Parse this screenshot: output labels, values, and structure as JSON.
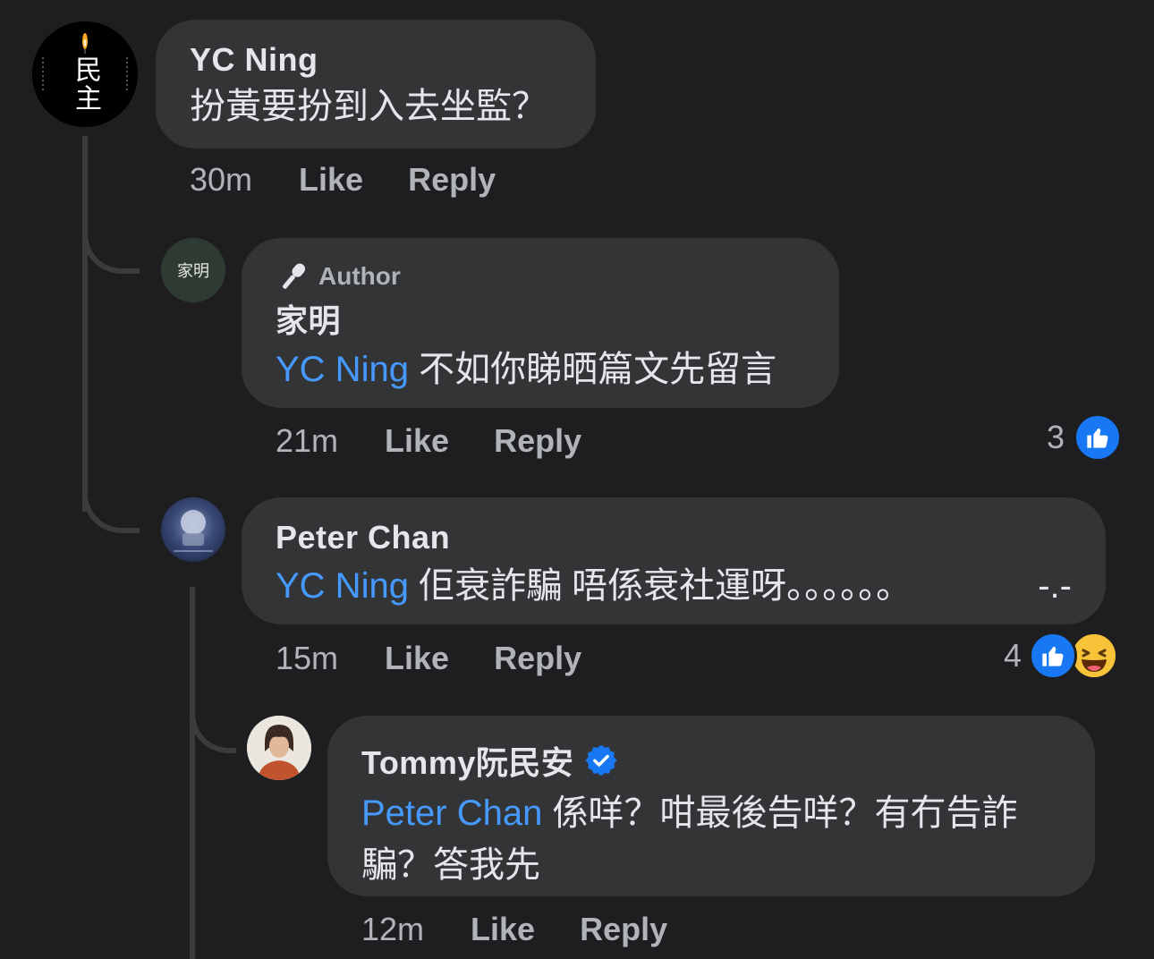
{
  "comments": [
    {
      "author": "YC Ning",
      "text": "扮黃要扮到入去坐監？",
      "time": "30m",
      "like_label": "Like",
      "reply_label": "Reply",
      "avatar_text": "民主"
    },
    {
      "badge": "Author",
      "author": "家明",
      "mention": "YC Ning",
      "text": " 不如你睇晒篇文先留言",
      "time": "21m",
      "like_label": "Like",
      "reply_label": "Reply",
      "reaction_count": "3",
      "avatar_text": "家明"
    },
    {
      "author": "Peter Chan",
      "mention": "YC Ning",
      "text": " 佢衰詐騙 唔係衰社運呀。。。。。。",
      "trailing": "-.-",
      "time": "15m",
      "like_label": "Like",
      "reply_label": "Reply",
      "reaction_count": "4"
    },
    {
      "author": "Tommy阮民安",
      "mention": "Peter Chan",
      "text": " 係咩？咁最後告咩？有冇告詐",
      "text_line2": "騙？答我先",
      "time": "12m",
      "like_label": "Like",
      "reply_label": "Reply"
    }
  ],
  "colors": {
    "background": "#1e1e20",
    "bubble": "#333436",
    "mention": "#4599ff",
    "like": "#1877f2",
    "verified": "#1877f2"
  }
}
